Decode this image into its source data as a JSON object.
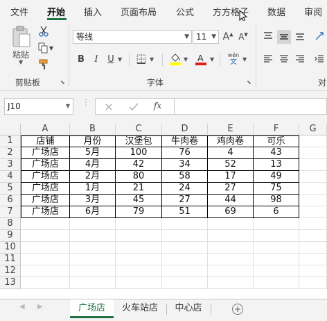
{
  "menu": {
    "tabs": [
      {
        "label": "文件",
        "active": false
      },
      {
        "label": "开始",
        "active": true
      },
      {
        "label": "插入",
        "active": false
      },
      {
        "label": "页面布局",
        "active": false
      },
      {
        "label": "公式",
        "active": false
      },
      {
        "label": "方方格子",
        "active": false
      },
      {
        "label": "数据",
        "active": false
      },
      {
        "label": "审阅",
        "active": false
      }
    ]
  },
  "ribbon": {
    "clipboard": {
      "paste_label": "粘贴",
      "group_label": "剪贴板"
    },
    "font": {
      "font_name": "等线",
      "font_size": "11",
      "bold": "B",
      "italic": "I",
      "underline": "U",
      "grow": "A",
      "shrink": "A",
      "color_a": "A",
      "phonetic_top": "wén",
      "phonetic_bottom": "文",
      "group_label": "字体"
    },
    "alignment": {
      "group_label": "对"
    }
  },
  "formula_bar": {
    "name_box": "J10",
    "fx_label": "fx",
    "formula": ""
  },
  "sheet": {
    "columns": [
      "A",
      "B",
      "C",
      "D",
      "E",
      "F",
      "G"
    ],
    "rows": [
      "1",
      "2",
      "3",
      "4",
      "5",
      "6",
      "7",
      "8",
      "9",
      "10",
      "11",
      "12",
      "13"
    ],
    "table": [
      [
        "店铺",
        "月份",
        "汉堡包",
        "牛肉卷",
        "鸡肉卷",
        "可乐"
      ],
      [
        "广场店",
        "5月",
        "100",
        "76",
        "4",
        "43"
      ],
      [
        "广场店",
        "4月",
        "42",
        "34",
        "52",
        "13"
      ],
      [
        "广场店",
        "2月",
        "80",
        "58",
        "17",
        "49"
      ],
      [
        "广场店",
        "1月",
        "21",
        "24",
        "27",
        "75"
      ],
      [
        "广场店",
        "3月",
        "45",
        "27",
        "44",
        "98"
      ],
      [
        "广场店",
        "6月",
        "79",
        "51",
        "69",
        "6"
      ]
    ]
  },
  "sheet_tabs": {
    "tabs": [
      {
        "label": "广场店",
        "active": true
      },
      {
        "label": "火车站店",
        "active": false
      },
      {
        "label": "中心店",
        "active": false
      }
    ],
    "add_label": "+"
  },
  "colors": {
    "accent": "#217346",
    "font_highlight": "#ffff00",
    "font_color": "#e02020"
  }
}
